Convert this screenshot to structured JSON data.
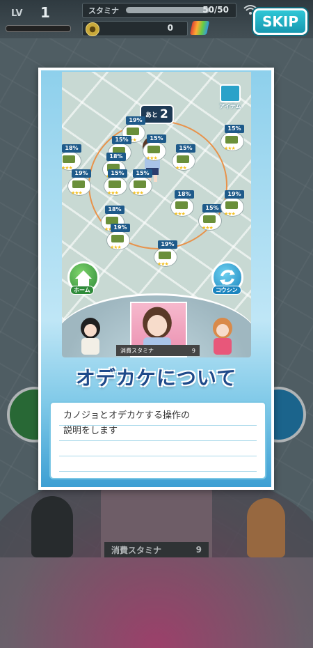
{
  "status": {
    "lv_label": "LV",
    "lv_value": "1",
    "stamina_label": "スタミナ",
    "stamina_value": "50/50",
    "stamina_fraction": 1.0,
    "coins": "0",
    "skip_label": "SKIP"
  },
  "background": {
    "stamina_label": "消費スタミナ",
    "stamina_value": "9"
  },
  "tutorial": {
    "screenshot": {
      "item_label": "アイテム",
      "ato_label": "あと",
      "ato_value": "2",
      "home_label": "ホーム",
      "koushin_label": "コウシン",
      "stamina_label": "消費スタミナ",
      "stamina_value": "9",
      "markers": [
        {
          "pct": "19%"
        },
        {
          "pct": "15%"
        },
        {
          "pct": "18%"
        },
        {
          "pct": "15%"
        },
        {
          "pct": "18%"
        },
        {
          "pct": "15%"
        },
        {
          "pct": "19%"
        },
        {
          "pct": "15%"
        },
        {
          "pct": "18%"
        },
        {
          "pct": "15%"
        },
        {
          "pct": "15%"
        },
        {
          "pct": "19%"
        },
        {
          "pct": "18%"
        },
        {
          "pct": "19%"
        },
        {
          "pct": "19%"
        },
        {
          "pct": "15%"
        }
      ]
    },
    "title": "オデカケについて",
    "message": "カノジョとオデカケする操作の\n説明をします"
  },
  "colors": {
    "skip_bg": "#1fa9c0",
    "title_text": "#1f4a8a",
    "message_border": "#7ac6e4",
    "marker_badge": "#1e5a8a"
  }
}
